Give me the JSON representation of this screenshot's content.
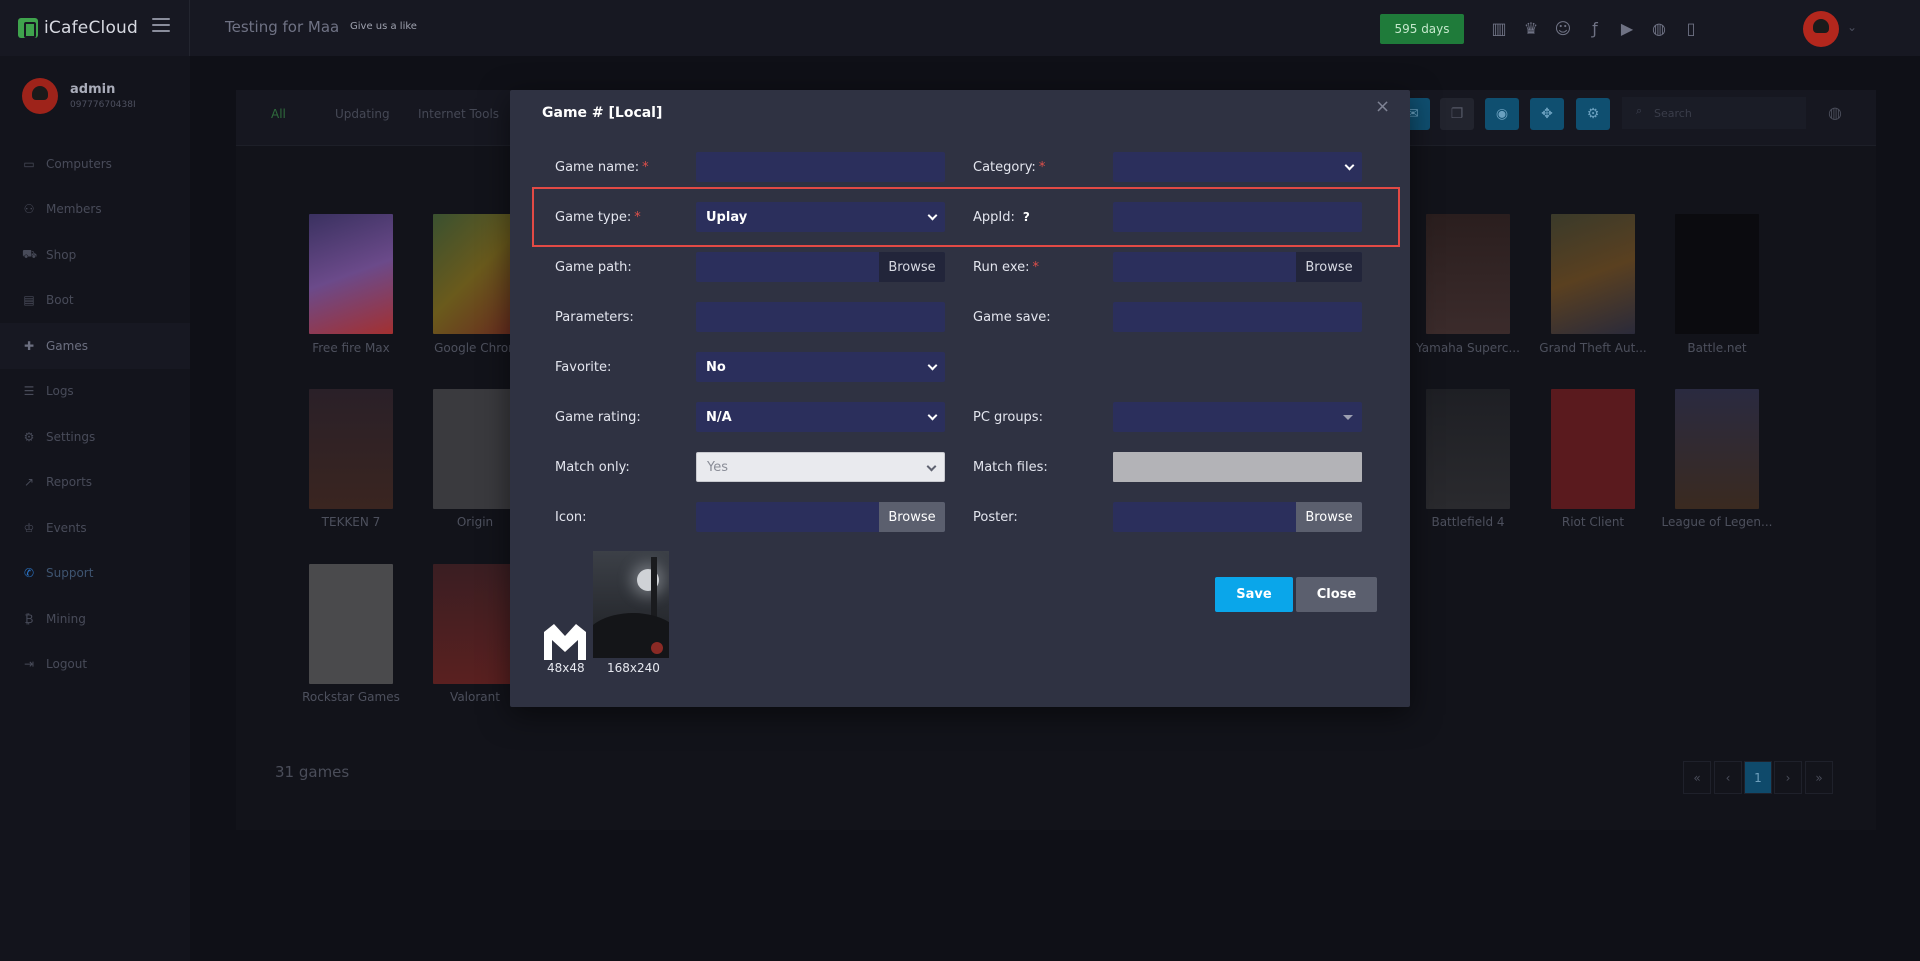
{
  "app": {
    "brand": "iCafeCloud",
    "title": "Testing for Maa",
    "subtitle": "Give us a like",
    "days_badge": "595 days"
  },
  "header_icons": [
    "leaderboard-icon",
    "trophy-icon",
    "discord-icon",
    "facebook-icon",
    "youtube-icon",
    "globe-icon",
    "book-icon"
  ],
  "user": {
    "name": "admin",
    "phone": "09777670438I"
  },
  "sidebar": {
    "items": [
      {
        "label": "Computers",
        "icon": "monitor-icon"
      },
      {
        "label": "Members",
        "icon": "users-icon"
      },
      {
        "label": "Shop",
        "icon": "cart-icon"
      },
      {
        "label": "Boot",
        "icon": "boot-icon"
      },
      {
        "label": "Games",
        "icon": "gamepad-icon"
      },
      {
        "label": "Logs",
        "icon": "list-icon"
      },
      {
        "label": "Settings",
        "icon": "gear-icon"
      },
      {
        "label": "Reports",
        "icon": "chart-icon"
      },
      {
        "label": "Events",
        "icon": "crown-icon"
      },
      {
        "label": "Support",
        "icon": "phone-icon"
      },
      {
        "label": "Mining",
        "icon": "bitcoin-icon"
      },
      {
        "label": "Logout",
        "icon": "logout-icon"
      }
    ]
  },
  "filters": {
    "all": "All",
    "updating": "Updating",
    "internet_tools": "Internet Tools",
    "search_placeholder": "Search"
  },
  "games": [
    "Free fire Max",
    "Google Chron",
    "Yamaha Superc...",
    "Grand Theft Aut...",
    "Battle.net",
    "TEKKEN 7",
    "Origin",
    "Battlefield 4",
    "Riot Client",
    "League of Legen...",
    "Rockstar Games",
    "Valorant"
  ],
  "game_count": "31 games",
  "pager": {
    "first": "«",
    "prev": "‹",
    "current": "1",
    "next": "›",
    "last": "»"
  },
  "modal": {
    "title": "Game # [Local]",
    "close": "×",
    "labels": {
      "game_name": "Game name:",
      "category": "Category:",
      "game_type": "Game type:",
      "appid": "AppId:",
      "game_path": "Game path:",
      "run_exe": "Run exe:",
      "parameters": "Parameters:",
      "game_save": "Game save:",
      "favorite": "Favorite:",
      "game_rating": "Game rating:",
      "pc_groups": "PC groups:",
      "match_only": "Match only:",
      "match_files": "Match files:",
      "icon": "Icon:",
      "poster": "Poster:"
    },
    "required_mark": "*",
    "help_mark": "?",
    "values": {
      "game_type": "Uplay",
      "favorite": "No",
      "game_rating": "N/A",
      "match_only": "Yes"
    },
    "browse": "Browse",
    "icon_size": "48x48",
    "poster_size": "168x240",
    "save": "Save",
    "close_btn": "Close"
  },
  "colors": {
    "accent": "#0aa6ea",
    "highlight": "#e24a45",
    "input_bg": "#2b2f5c",
    "modal_bg": "#2f3242"
  }
}
